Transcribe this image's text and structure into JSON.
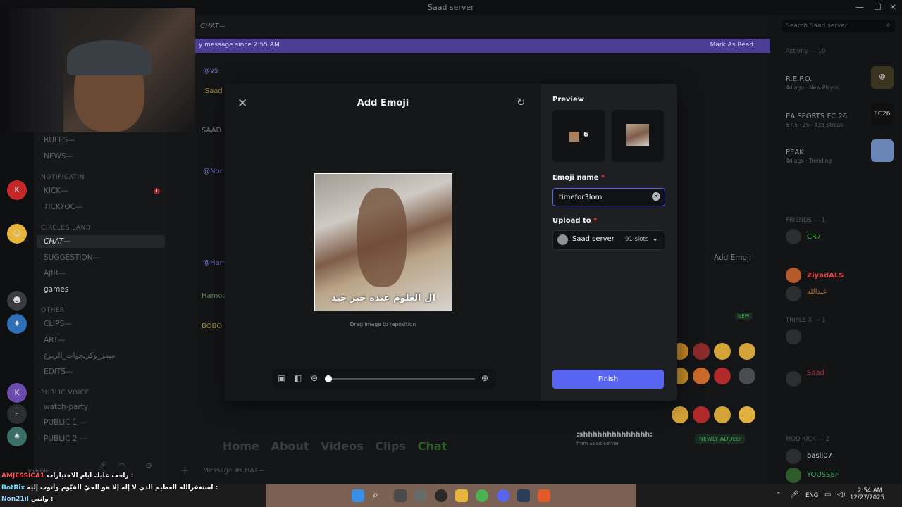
{
  "window": {
    "title": "Saad server"
  },
  "channel": {
    "name": "CHAT—"
  },
  "new_messages": {
    "text": "y message since 2:55 AM",
    "action": "Mark As Read"
  },
  "search": {
    "placeholder": "Search Saad server"
  },
  "sidebar": {
    "channels_top": [
      {
        "label": "RULES—"
      },
      {
        "label": "NEWS—"
      }
    ],
    "categories": [
      {
        "label": "NOTIFICATIN"
      },
      {
        "label": "CIRCLES LAND"
      },
      {
        "label": "OTHER"
      },
      {
        "label": "PUBLIC VOICE"
      }
    ],
    "channels_notif": [
      {
        "label": "KICK—"
      },
      {
        "label": "TICKTOC—"
      }
    ],
    "channels_circles": [
      {
        "label": "CHAT—"
      },
      {
        "label": "SUGGESTION—"
      },
      {
        "label": "AJIR—"
      },
      {
        "label": "games"
      }
    ],
    "channels_other": [
      {
        "label": "CLIPS—"
      },
      {
        "label": "ART—"
      },
      {
        "label": "ميمز_وكرنجوات_الربوع"
      },
      {
        "label": "EDITS—"
      }
    ],
    "voice": [
      {
        "label": "watch-party"
      },
      {
        "label": "PUBLIC 1 —"
      },
      {
        "label": "PUBLIC 2 —"
      }
    ],
    "user_status": "Invisible",
    "message_placeholder": "Message #CHAT—"
  },
  "chat_fragments": {
    "author1": "@vs",
    "author2": "iSaad",
    "author3": "SAAD",
    "author4": "@Non",
    "author5": "@Ham",
    "author6": "Hamod",
    "author7": "BOBO",
    "add_emoji_bg": "Add Emoji",
    "new_tag": "NEW",
    "newly_added": "NEWLY ADDED",
    "shout": ":shhhhhhhhhhhhhh:",
    "shout_sub": "from Saad server",
    "profile_tabs": [
      "Home",
      "About",
      "Videos",
      "Clips",
      "Chat"
    ]
  },
  "members": {
    "activity_header": "Activity — 10",
    "activities": [
      {
        "title": "R.E.P.O.",
        "sub": "4d ago  ·  New Player"
      },
      {
        "title": "EA SPORTS FC 26",
        "sub": "5 / 5  ·  25  ·  43d Streak"
      },
      {
        "title": "PEAK",
        "sub": "4d ago  ·  Trending"
      }
    ],
    "sections": [
      {
        "label": "FRIENDS — 1"
      },
      {
        "label": "TRIPLE X — 1"
      },
      {
        "label": "MOD KICK — 2"
      }
    ],
    "names": [
      {
        "name": "CR7"
      },
      {
        "name": "ZiyadALS"
      },
      {
        "name": "عبدالله"
      },
      {
        "name": "Saad"
      },
      {
        "name": "basli07"
      },
      {
        "name": "YOUSSEF"
      }
    ],
    "game_icons": [
      {
        "label": "FC26"
      }
    ]
  },
  "modal": {
    "title": "Add Emoji",
    "drag_hint": "Drag image to reposition",
    "image_caption": "ال العلوم عنده خبر جيد",
    "zoom_level": 0,
    "preview_label": "Preview",
    "preview_count": "6",
    "name_label": "Emoji name",
    "name_value": "timefor3lom",
    "upload_label": "Upload to",
    "upload_server": "Saad server",
    "upload_slots": "91 slots",
    "finish_label": "Finish",
    "required_mark": "*"
  },
  "stream_overlay": [
    {
      "user": "AMJESSICA1",
      "text": "راحت عليك ايام الاختيارات :",
      "color": "#ff5757"
    },
    {
      "user": "BotRix",
      "text": "استغفرالله العظيم الذي لا إله إلا هو الحيّ القيّوم وأتوب إليه :",
      "color": "#66e0ff"
    },
    {
      "user": "Non21il",
      "text": "وانس :",
      "color": "#8fd3ff"
    }
  ],
  "taskbar": {
    "lang": "ENG",
    "time": "2:54 AM",
    "date": "12/27/2025"
  },
  "colors": {
    "accent": "#5865f2",
    "banner": "#4b3e94",
    "danger": "#f23f42"
  }
}
